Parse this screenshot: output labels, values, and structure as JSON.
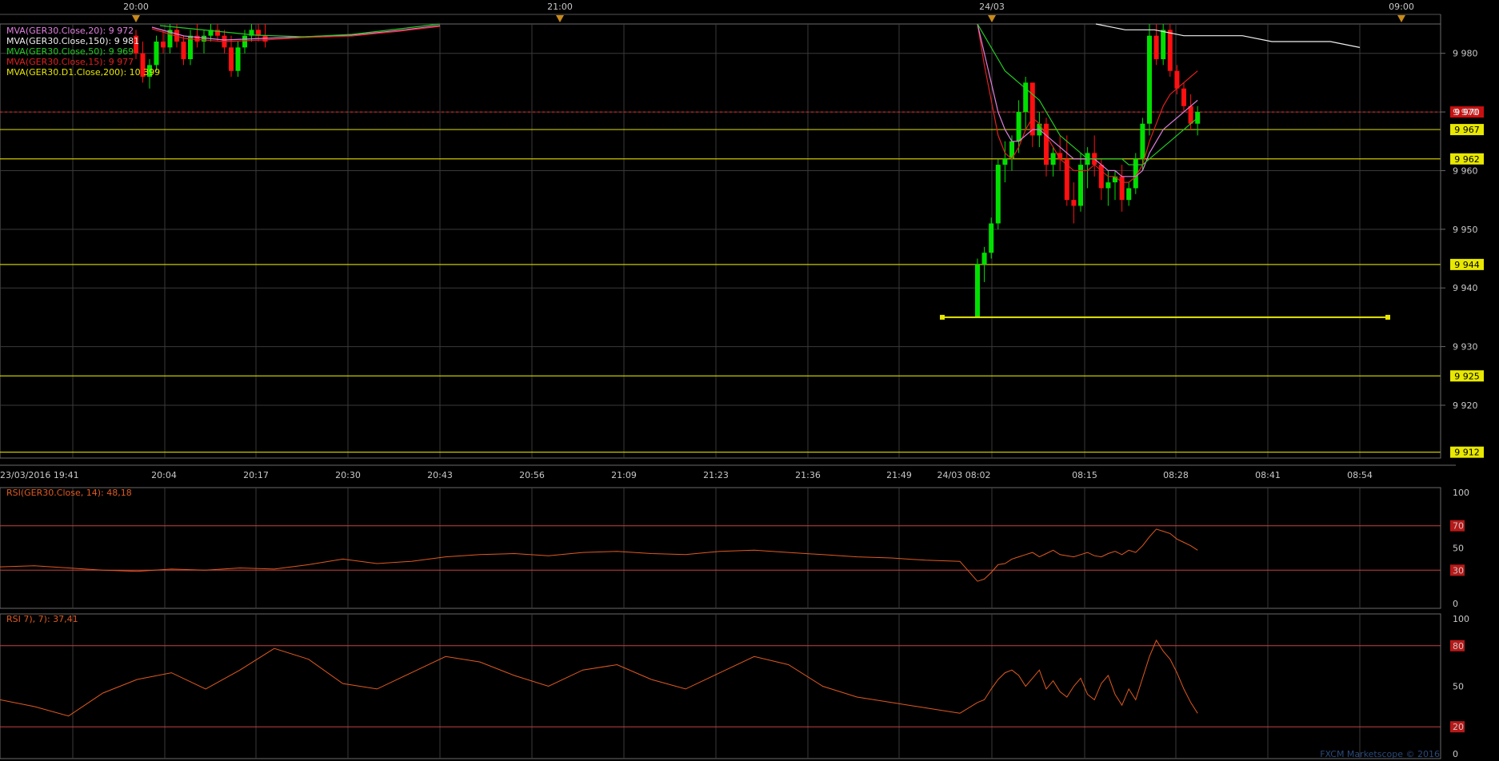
{
  "chart_data": [
    {
      "type": "candlestick",
      "title": "",
      "top_time_labels": [
        "20:00",
        "21:00",
        "24/03",
        "09:00"
      ],
      "bottom_time_labels": [
        "23/03/2016 19:41",
        "20:04",
        "20:17",
        "20:30",
        "20:43",
        "20:56",
        "21:09",
        "21:23",
        "21:36",
        "21:49",
        "24/03 08:02",
        "08:15",
        "08:28",
        "08:41",
        "08:54"
      ],
      "ylim": [
        9911,
        9985
      ],
      "y_ticks": [
        {
          "v": 9980,
          "label": "9 980"
        },
        {
          "v": 9970,
          "label": "9 970"
        },
        {
          "v": 9960,
          "label": "9 960"
        },
        {
          "v": 9950,
          "label": "9 950"
        },
        {
          "v": 9940,
          "label": "9 940"
        },
        {
          "v": 9930,
          "label": "9 930"
        },
        {
          "v": 9920,
          "label": "9 920"
        }
      ],
      "legend": [
        {
          "text": "MVA(GER30.Close,20): 9 972",
          "color": "#e080e0"
        },
        {
          "text": "MVA(GER30.Close,150): 9 981",
          "color": "#f0f0f0"
        },
        {
          "text": "MVA(GER30.Close,50): 9 969",
          "color": "#22cc22"
        },
        {
          "text": "MVA(GER30.Close,15): 9 977",
          "color": "#e02020"
        },
        {
          "text": "MVA(GER30.D1.Close,200): 10 399",
          "color": "#e8e800"
        }
      ],
      "current_price": {
        "value": 9970,
        "label": "9 970",
        "color": "#ff2020"
      },
      "hlines": [
        {
          "value": 9967,
          "label": "9 967"
        },
        {
          "value": 9962,
          "label": "9 962"
        },
        {
          "value": 9944,
          "label": "9 944"
        },
        {
          "value": 9925,
          "label": "9 925"
        },
        {
          "value": 9912,
          "label": "9 912"
        }
      ],
      "trendline": {
        "y": 9935,
        "x_from": 984,
        "x_to": 1451,
        "x_units": "pane-pixel-hint"
      },
      "candles_session1": [
        [
          9983,
          9984,
          9979,
          9980
        ],
        [
          9980,
          9982,
          9975,
          9976
        ],
        [
          9976,
          9979,
          9974,
          9978
        ],
        [
          9978,
          9983,
          9977,
          9982
        ],
        [
          9982,
          9984,
          9980,
          9981
        ],
        [
          9981,
          9985,
          9980,
          9984
        ],
        [
          9984,
          9985,
          9981,
          9982
        ],
        [
          9982,
          9983,
          9978,
          9979
        ],
        [
          9979,
          9984,
          9978,
          9983
        ],
        [
          9983,
          9985,
          9981,
          9982
        ],
        [
          9982,
          9984,
          9980,
          9983
        ],
        [
          9983,
          9985,
          9982,
          9984
        ],
        [
          9984,
          9985,
          9982,
          9983
        ],
        [
          9983,
          9984,
          9980,
          9981
        ],
        [
          9981,
          9983,
          9976,
          9977
        ],
        [
          9977,
          9982,
          9976,
          9981
        ],
        [
          9981,
          9984,
          9980,
          9983
        ],
        [
          9983,
          9985,
          9982,
          9984
        ],
        [
          9984,
          9985,
          9982,
          9983
        ],
        [
          9983,
          9985,
          9981,
          9982
        ]
      ],
      "candles_session2": [
        [
          9935,
          9945,
          9935,
          9944
        ],
        [
          9944,
          9947,
          9941,
          9946
        ],
        [
          9946,
          9952,
          9945,
          9951
        ],
        [
          9951,
          9962,
          9950,
          9961
        ],
        [
          9961,
          9965,
          9958,
          9962
        ],
        [
          9962,
          9966,
          9960,
          9965
        ],
        [
          9965,
          9972,
          9963,
          9970
        ],
        [
          9970,
          9976,
          9967,
          9975
        ],
        [
          9975,
          9974,
          9964,
          9966
        ],
        [
          9966,
          9970,
          9964,
          9968
        ],
        [
          9968,
          9969,
          9959,
          9961
        ],
        [
          9961,
          9964,
          9959,
          9963
        ],
        [
          9963,
          9966,
          9960,
          9962
        ],
        [
          9962,
          9966,
          9954,
          9955
        ],
        [
          9955,
          9958,
          9951,
          9954
        ],
        [
          9954,
          9963,
          9953,
          9961
        ],
        [
          9961,
          9964,
          9957,
          9963
        ],
        [
          9963,
          9966,
          9959,
          9961
        ],
        [
          9961,
          9962,
          9955,
          9957
        ],
        [
          9957,
          9960,
          9954,
          9958
        ],
        [
          9958,
          9960,
          9955,
          9959
        ],
        [
          9959,
          9961,
          9953,
          9955
        ],
        [
          9955,
          9958,
          9954,
          9957
        ],
        [
          9957,
          9963,
          9956,
          9962
        ],
        [
          9962,
          9969,
          9960,
          9968
        ],
        [
          9968,
          9985,
          9966,
          9983
        ],
        [
          9983,
          9985,
          9978,
          9979
        ],
        [
          9979,
          9985,
          9978,
          9984
        ],
        [
          9984,
          9985,
          9976,
          9977
        ],
        [
          9977,
          9978,
          9973,
          9974
        ],
        [
          9974,
          9975,
          9970,
          9971
        ],
        [
          9971,
          9973,
          9967,
          9968
        ],
        [
          9968,
          9971,
          9966,
          9970
        ]
      ],
      "ma_session2": [
        {
          "name": "MVA(GER30.Close,15)",
          "color": "#e02020",
          "values": [
            9985,
            9978,
            9972,
            9966,
            9963,
            9962,
            9964,
            9967,
            9969,
            9968,
            9966,
            9964,
            9962,
            9961,
            9960,
            9960,
            9960,
            9961,
            9960,
            9959,
            9959,
            9958,
            9958,
            9959,
            9961,
            9965,
            9968,
            9971,
            9973,
            9974,
            9975,
            9976,
            9977
          ]
        },
        {
          "name": "MVA(GER30.Close,20)",
          "color": "#e080e0",
          "values": [
            9985,
            9980,
            9975,
            9970,
            9967,
            9965,
            9965,
            9966,
            9967,
            9967,
            9966,
            9965,
            9964,
            9963,
            9962,
            9962,
            9962,
            9962,
            9961,
            9960,
            9960,
            9959,
            9959,
            9959,
            9960,
            9963,
            9965,
            9967,
            9968,
            9969,
            9970,
            9971,
            9972
          ]
        },
        {
          "name": "MVA(GER30.Close,50)",
          "color": "#22cc22",
          "values": [
            9985,
            9983,
            9981,
            9979,
            9977,
            9976,
            9975,
            9974,
            9973,
            9972,
            9970,
            9968,
            9966,
            9965,
            9964,
            9963,
            9962,
            9962,
            9962,
            9962,
            9962,
            9962,
            9961,
            9961,
            9961,
            9962,
            9963,
            9964,
            9965,
            9966,
            9967,
            9968,
            9969
          ]
        },
        {
          "name": "MVA(GER30.Close,150)",
          "color": "#f0f0f0",
          "values": [
            9985,
            9984,
            9984,
            9983,
            9983,
            9983,
            9982,
            9982,
            9982,
            9981
          ]
        }
      ]
    },
    {
      "type": "line",
      "title": "RSI(GER30.Close, 14): 48,18",
      "ylim": [
        0,
        100
      ],
      "y_ticks": [
        {
          "v": 100,
          "label": "100",
          "hl": false
        },
        {
          "v": 70,
          "label": "70",
          "hl": true
        },
        {
          "v": 50,
          "label": "50",
          "hl": false
        },
        {
          "v": 30,
          "label": "30",
          "hl": true
        },
        {
          "v": 0,
          "label": "0",
          "hl": false
        }
      ],
      "levels": [
        70,
        30
      ],
      "series": [
        {
          "color": "#e05a20",
          "values_session1": [
            33,
            34,
            32,
            30,
            29,
            31,
            30,
            32,
            31,
            35,
            40,
            36,
            38,
            42,
            44,
            45,
            43,
            46,
            47,
            45,
            44,
            47,
            48,
            46,
            44,
            42,
            41,
            39,
            38
          ],
          "values_session2": [
            20,
            22,
            28,
            35,
            36,
            40,
            42,
            44,
            46,
            42,
            45,
            48,
            44,
            43,
            42,
            44,
            46,
            43,
            42,
            45,
            47,
            44,
            48,
            46,
            52,
            60,
            67,
            65,
            63,
            58,
            55,
            52,
            48
          ]
        }
      ]
    },
    {
      "type": "line",
      "title": "RSI 7), 7): 37,41",
      "ylim": [
        0,
        100
      ],
      "y_ticks": [
        {
          "v": 100,
          "label": "100",
          "hl": false
        },
        {
          "v": 80,
          "label": "80",
          "hl": true
        },
        {
          "v": 50,
          "label": "50",
          "hl": false
        },
        {
          "v": 20,
          "label": "20",
          "hl": true
        },
        {
          "v": 0,
          "label": "0",
          "hl": false
        }
      ],
      "levels": [
        80,
        20
      ],
      "series": [
        {
          "color": "#e05a20",
          "values_session1": [
            40,
            35,
            28,
            45,
            55,
            60,
            48,
            62,
            78,
            70,
            52,
            48,
            60,
            72,
            68,
            58,
            50,
            62,
            66,
            55,
            48,
            60,
            72,
            66,
            50,
            42,
            38,
            34,
            30
          ],
          "values_session2": [
            38,
            40,
            48,
            55,
            60,
            62,
            58,
            50,
            56,
            62,
            48,
            54,
            46,
            42,
            50,
            56,
            44,
            40,
            52,
            58,
            44,
            36,
            48,
            40,
            56,
            72,
            84,
            76,
            70,
            60,
            48,
            38,
            30
          ]
        }
      ]
    }
  ],
  "watermark": "FXCM Marketscope © 2016"
}
